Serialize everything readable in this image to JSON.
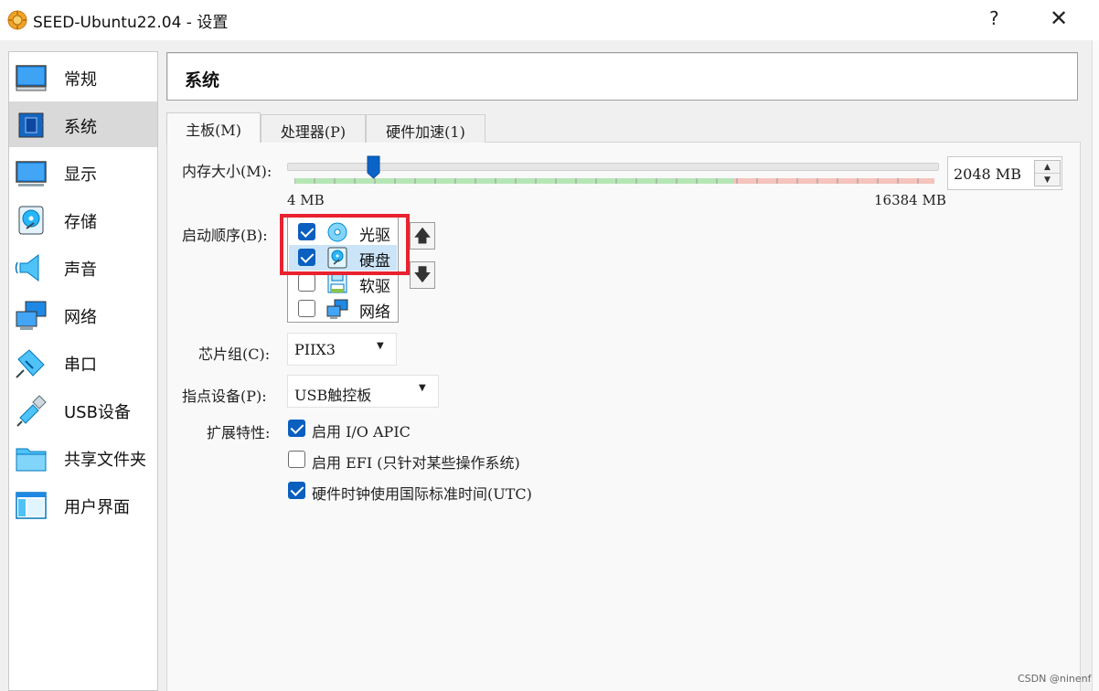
{
  "window": {
    "title": "SEED-Ubuntu22.04 - 设置",
    "help_label": "?",
    "close_label": "✕"
  },
  "sidebar": {
    "items": [
      {
        "label": "常规",
        "icon": "general-icon"
      },
      {
        "label": "系统",
        "icon": "system-icon",
        "active": true
      },
      {
        "label": "显示",
        "icon": "display-icon"
      },
      {
        "label": "存储",
        "icon": "storage-icon"
      },
      {
        "label": "声音",
        "icon": "audio-icon"
      },
      {
        "label": "网络",
        "icon": "network-icon"
      },
      {
        "label": "串口",
        "icon": "serial-port-icon"
      },
      {
        "label": "USB设备",
        "icon": "usb-icon"
      },
      {
        "label": "共享文件夹",
        "icon": "shared-folder-icon"
      },
      {
        "label": "用户界面",
        "icon": "user-interface-icon"
      }
    ]
  },
  "page": {
    "title": "系统"
  },
  "tabs": [
    {
      "label": "主板(M)",
      "active": true
    },
    {
      "label": "处理器(P)"
    },
    {
      "label": "硬件加速(1)"
    }
  ],
  "motherboard": {
    "memory": {
      "label": "内存大小(M):",
      "min_label": "4 MB",
      "max_label": "16384 MB",
      "value": "2048 MB",
      "value_mb": 2048,
      "min_mb": 4,
      "max_mb": 16384
    },
    "boot_order": {
      "label": "启动顺序(B):",
      "items": [
        {
          "label": "光驱",
          "checked": true,
          "icon": "optical-disc-icon"
        },
        {
          "label": "硬盘",
          "checked": true,
          "icon": "hard-disk-icon",
          "selected": true
        },
        {
          "label": "软驱",
          "checked": false,
          "icon": "floppy-icon"
        },
        {
          "label": "网络",
          "checked": false,
          "icon": "network-icon"
        }
      ],
      "move_up_label": "🡅",
      "move_down_label": "🡇"
    },
    "chipset": {
      "label": "芯片组(C):",
      "value": "PIIX3"
    },
    "pointing_device": {
      "label": "指点设备(P):",
      "value": "USB触控板"
    },
    "extended_features": {
      "label": "扩展特性:",
      "options": [
        {
          "label": "启用 I/O APIC",
          "checked": true
        },
        {
          "label": "启用 EFI (只针对某些操作系统)",
          "checked": false
        },
        {
          "label": "硬件时钟使用国际标准时间(UTC)",
          "checked": true
        }
      ]
    }
  },
  "watermark": "CSDN @ninenf",
  "colors": {
    "accent": "#0a5fbf",
    "highlight": "#e8222f",
    "selection": "#cce4f7"
  }
}
